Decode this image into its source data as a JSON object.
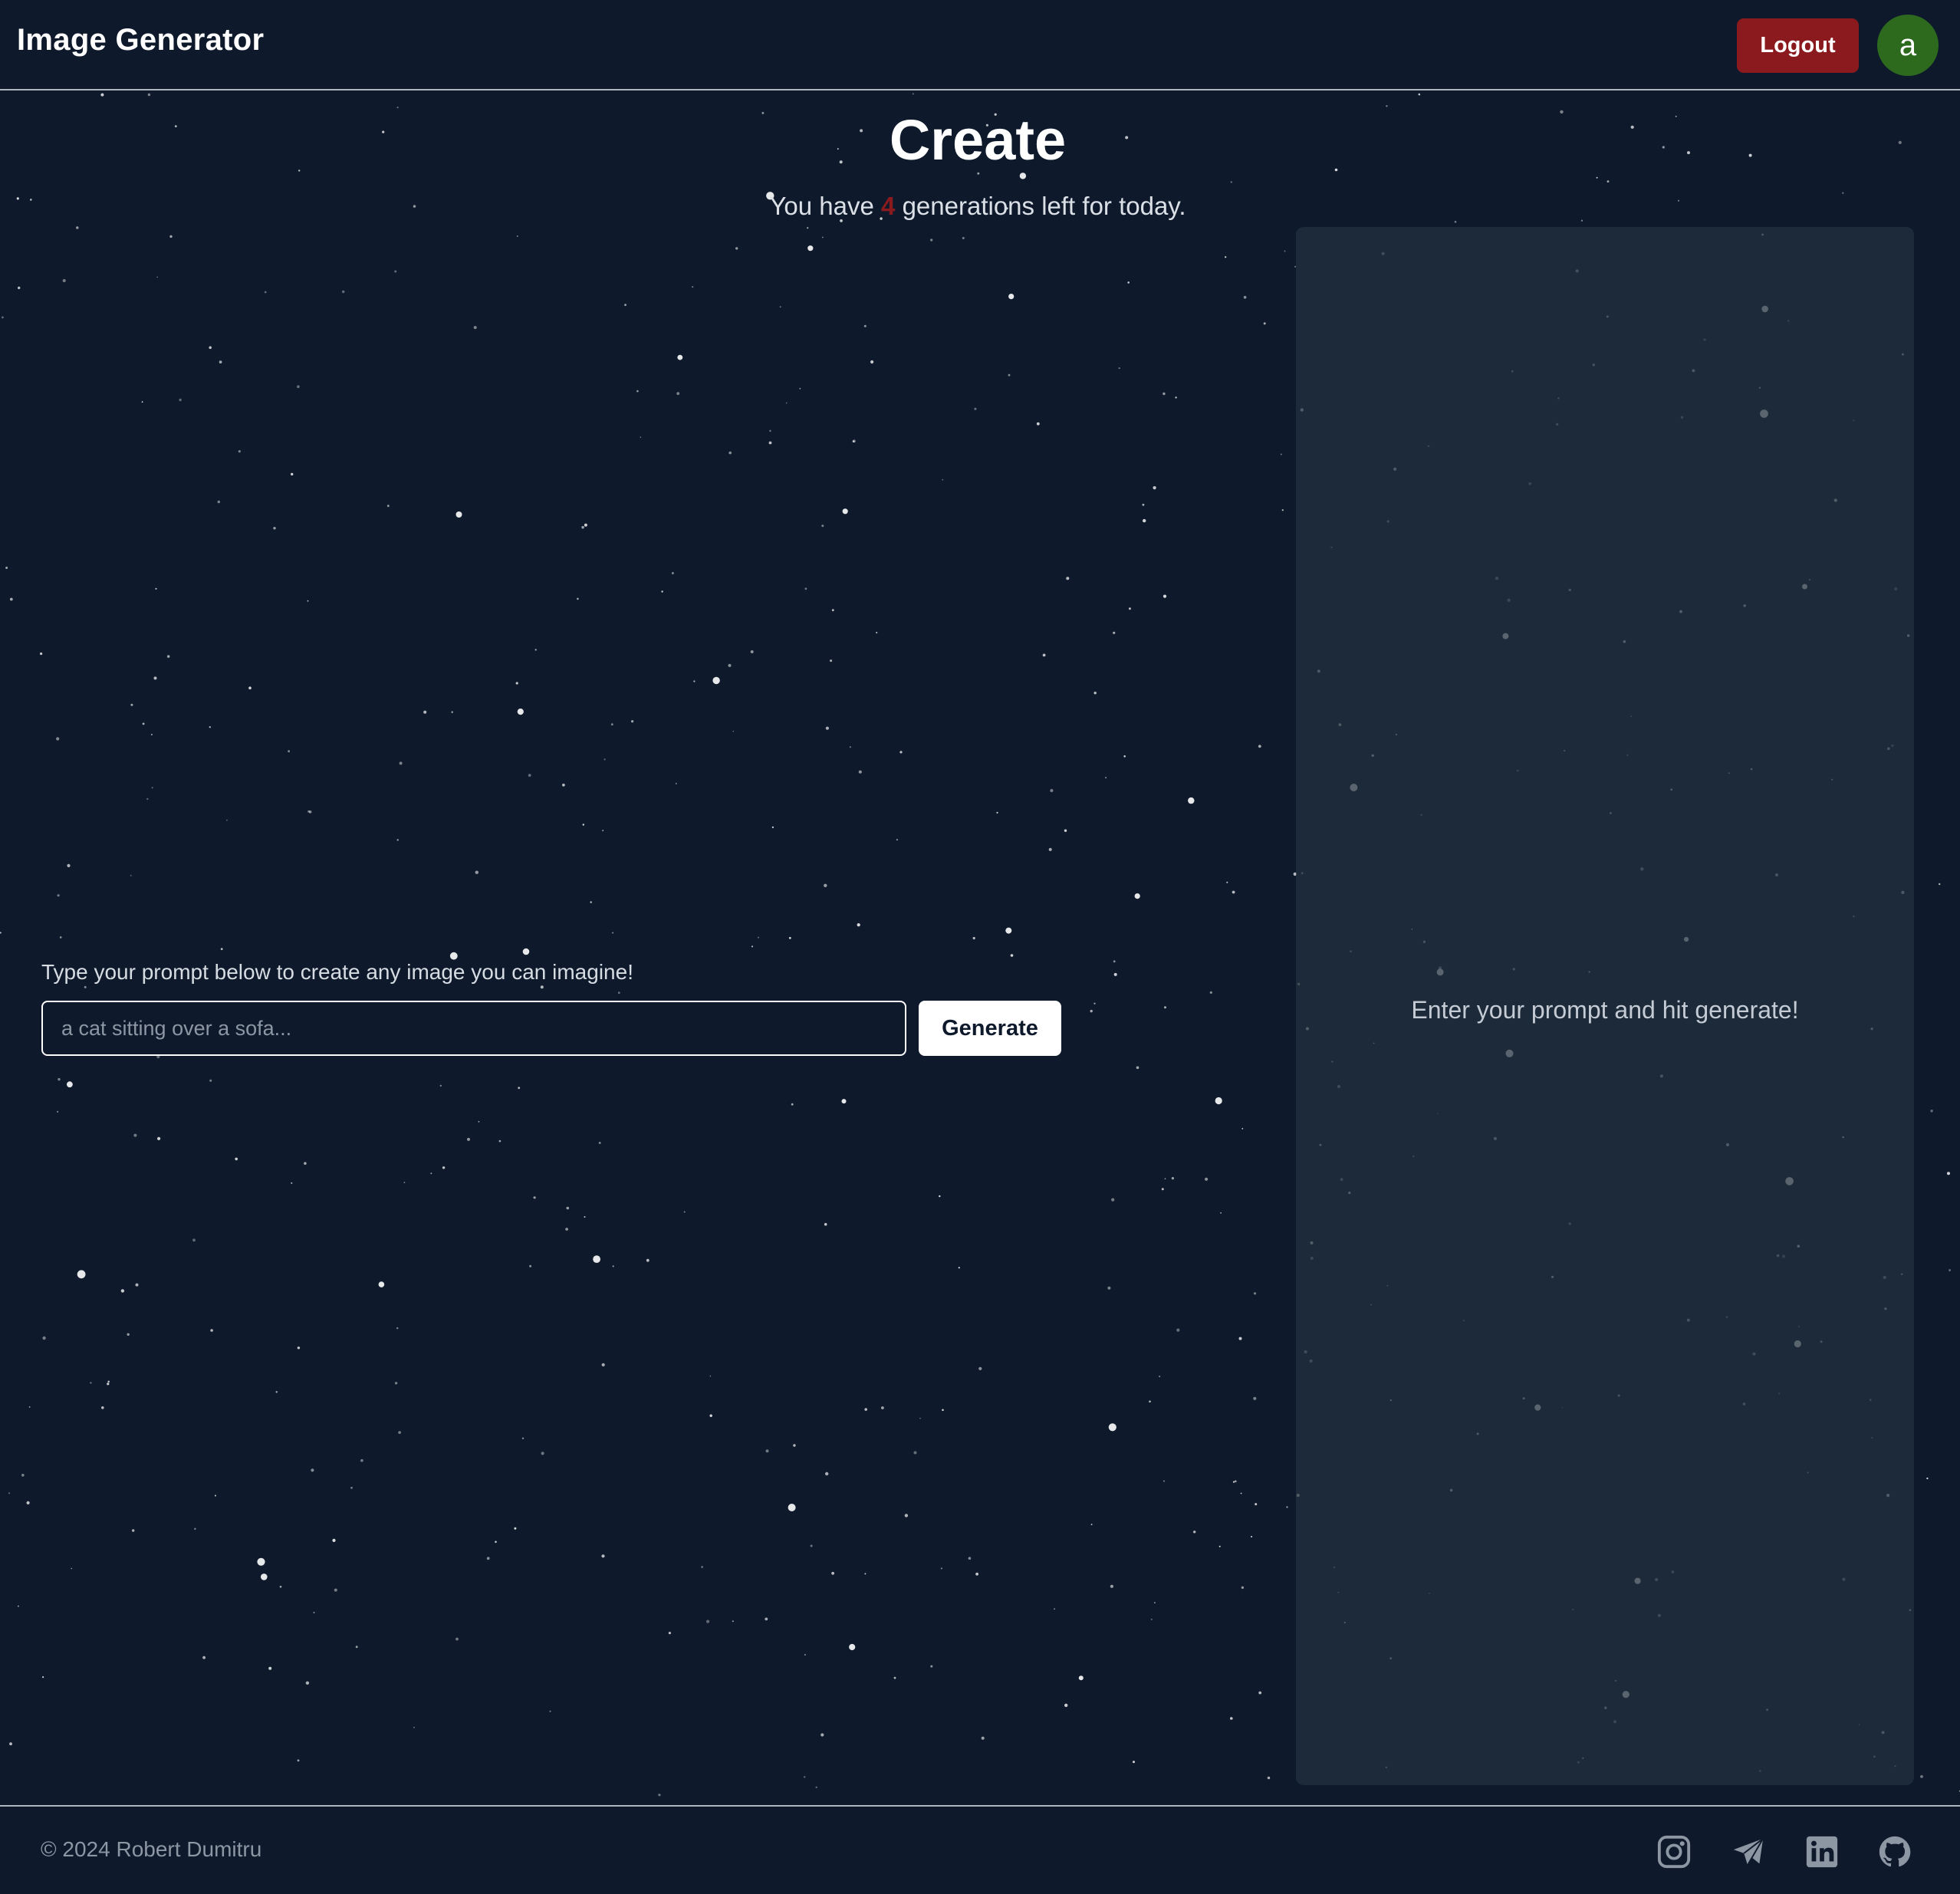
{
  "header": {
    "brand": "Image Generator",
    "logout_label": "Logout",
    "avatar_initial": "a",
    "colors": {
      "logout_bg": "#8b1a1f",
      "avatar_bg": "#2e6a1e"
    }
  },
  "main": {
    "title": "Create",
    "subtitle_prefix": "You have",
    "generations_left": "4",
    "subtitle_suffix": "generations left for today.",
    "prompt_label": "Type your prompt below to create any image you can imagine!",
    "prompt_placeholder": "a cat sitting over a sofa...",
    "prompt_value": "",
    "generate_label": "Generate"
  },
  "preview": {
    "empty_text": "Enter your prompt and hit generate!"
  },
  "footer": {
    "copyright": "© 2024 Robert Dumitru",
    "social_icons": [
      "instagram-icon",
      "telegram-icon",
      "linkedin-icon",
      "github-icon"
    ]
  },
  "theme": {
    "background": "#0e1a2c",
    "panel": "#1b2735",
    "accent_red": "#8b1a1f"
  }
}
